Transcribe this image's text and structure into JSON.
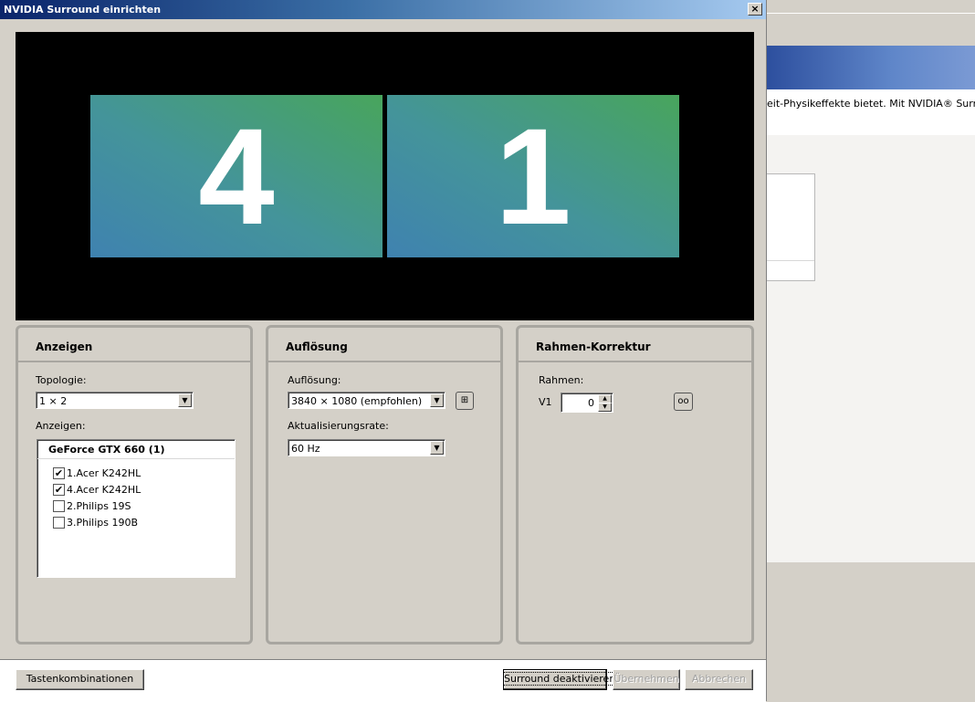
{
  "dialog": {
    "title": "NVIDIA Surround einrichten",
    "close_label": "×"
  },
  "preview": {
    "monitors": [
      {
        "label": "4"
      },
      {
        "label": "1"
      }
    ]
  },
  "panels": {
    "anzeigen": {
      "title": "Anzeigen",
      "topologie_label": "Topologie:",
      "topologie_value": "1 × 2",
      "anzeigen_label": "Anzeigen:",
      "gpu_header": "GeForce GTX 660 (1)",
      "displays": [
        {
          "label": "1.Acer K242HL",
          "checked": true,
          "mark": "✔"
        },
        {
          "label": "4.Acer K242HL",
          "checked": true,
          "mark": "✔"
        },
        {
          "label": "2.Philips 19S",
          "checked": false,
          "mark": ""
        },
        {
          "label": "3.Philips 190B",
          "checked": false,
          "mark": ""
        }
      ]
    },
    "aufloesung": {
      "title": "Auflösung",
      "aufloesung_label": "Auflösung:",
      "aufloesung_value": "3840 × 1080 (empfohlen)",
      "rate_label": "Aktualisierungsrate:",
      "rate_value": "60  Hz"
    },
    "rahmen": {
      "title": "Rahmen-Korrektur",
      "rahmen_label": "Rahmen:",
      "v1_label": "V1",
      "v1_value": "0"
    }
  },
  "footer": {
    "shortcuts_label": "Tastenkombinationen",
    "deactivate_label": "Surround deaktivieren",
    "apply_label": "Übernehmen",
    "cancel_label": "Abbrechen"
  },
  "background_window": {
    "text": "eit-Physikeffekte bietet. Mit NVIDIA® Surround k"
  },
  "colors": {
    "titlebar_start": "#0a246a",
    "monitor_blue": "#3f82b0",
    "monitor_green": "#48a55c"
  }
}
